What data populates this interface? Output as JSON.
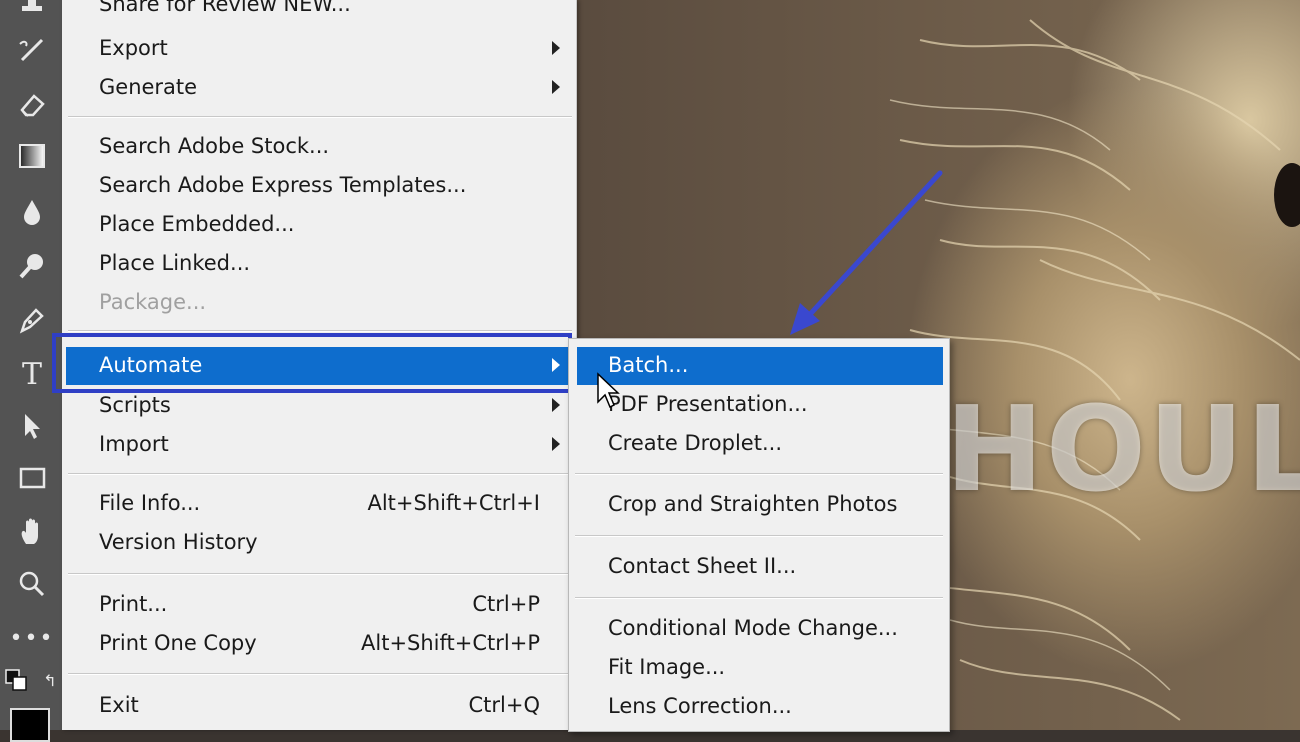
{
  "file_menu": {
    "items": [
      {
        "label": "Share for Review NEW...",
        "shortcut": "",
        "submenu": false,
        "disabled": false
      },
      {
        "label": "Export",
        "shortcut": "",
        "submenu": true,
        "disabled": false
      },
      {
        "label": "Generate",
        "shortcut": "",
        "submenu": true,
        "disabled": false
      },
      {
        "label": "Search Adobe Stock...",
        "shortcut": "",
        "submenu": false,
        "disabled": false
      },
      {
        "label": "Search Adobe Express Templates...",
        "shortcut": "",
        "submenu": false,
        "disabled": false
      },
      {
        "label": "Place Embedded...",
        "shortcut": "",
        "submenu": false,
        "disabled": false
      },
      {
        "label": "Place Linked...",
        "shortcut": "",
        "submenu": false,
        "disabled": false
      },
      {
        "label": "Package...",
        "shortcut": "",
        "submenu": false,
        "disabled": true
      },
      {
        "label": "Automate",
        "shortcut": "",
        "submenu": true,
        "disabled": false,
        "active": true
      },
      {
        "label": "Scripts",
        "shortcut": "",
        "submenu": true,
        "disabled": false
      },
      {
        "label": "Import",
        "shortcut": "",
        "submenu": true,
        "disabled": false
      },
      {
        "label": "File Info...",
        "shortcut": "Alt+Shift+Ctrl+I",
        "submenu": false,
        "disabled": false
      },
      {
        "label": "Version History",
        "shortcut": "",
        "submenu": false,
        "disabled": false
      },
      {
        "label": "Print...",
        "shortcut": "Ctrl+P",
        "submenu": false,
        "disabled": false
      },
      {
        "label": "Print One Copy",
        "shortcut": "Alt+Shift+Ctrl+P",
        "submenu": false,
        "disabled": false
      },
      {
        "label": "Exit",
        "shortcut": "Ctrl+Q",
        "submenu": false,
        "disabled": false
      }
    ]
  },
  "automate_submenu": {
    "items": [
      {
        "label": "Batch...",
        "active": true
      },
      {
        "label": "PDF Presentation..."
      },
      {
        "label": "Create Droplet..."
      },
      {
        "label": "Crop and Straighten Photos"
      },
      {
        "label": "Contact Sheet II..."
      },
      {
        "label": "Conditional Mode Change..."
      },
      {
        "label": "Fit Image..."
      },
      {
        "label": "Lens Correction..."
      }
    ]
  },
  "canvas": {
    "watermark_text": "HOUL"
  },
  "colors": {
    "highlight": "#0e6dcd",
    "annotation": "#2f3fc5",
    "menu_bg": "#f0f0f0",
    "toolbar_bg": "#535353"
  },
  "tools": [
    "stamp-icon",
    "history-brush-icon",
    "eraser-icon",
    "gradient-icon",
    "blur-icon",
    "dodge-icon",
    "pen-icon",
    "type-icon",
    "path-selection-icon",
    "rectangle-icon",
    "hand-icon",
    "zoom-icon",
    "more-tools-icon",
    "default-colors-icon",
    "swap-colors-icon",
    "foreground-color-swatch"
  ]
}
